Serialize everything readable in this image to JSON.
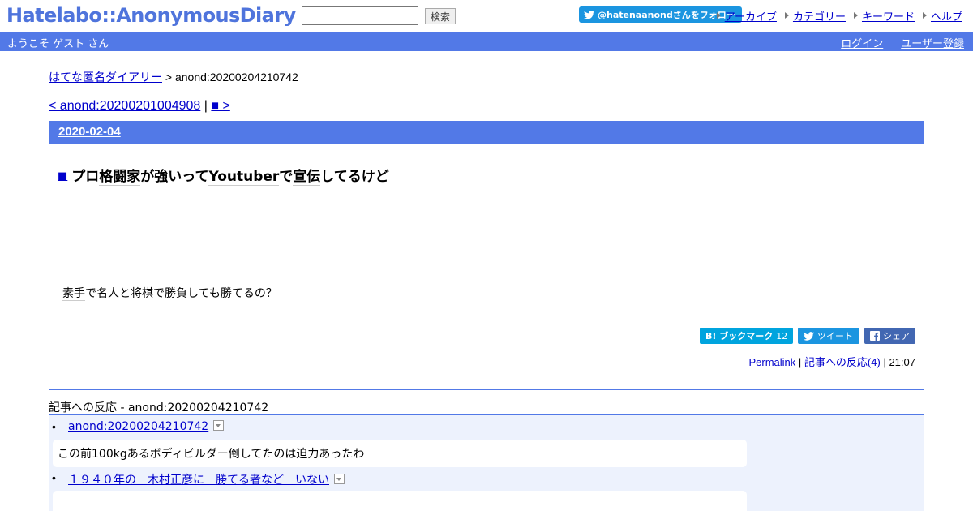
{
  "header": {
    "logo": "Hatelabo::AnonymousDiary",
    "search_placeholder": "",
    "search_button": "検索",
    "twitter_follow": "@hatenaanondさんをフォロー",
    "links": [
      "アーカイブ",
      "カテゴリー",
      "キーワード",
      "ヘルプ"
    ]
  },
  "bar": {
    "welcome": "ようこそ ゲスト さん",
    "login": "ログイン",
    "register": "ユーザー登録"
  },
  "breadcrumb": {
    "home": "はてな匿名ダイアリー",
    "separator": ">",
    "current": "anond:20200204210742"
  },
  "pager": {
    "prev": "< anond:20200201004908",
    "separator": "|",
    "next": "■ >"
  },
  "entry": {
    "date": "2020-02-04",
    "square": "■",
    "title_parts": [
      "プロ",
      "格闘家",
      "が強いって",
      "Youtuber",
      "で",
      "宣伝",
      "してるけど"
    ],
    "body_parts": [
      "素手",
      "で名人と将棋で勝負しても勝てるの？"
    ],
    "share": {
      "hatena_label": "B! ブックマーク",
      "hatena_count": "12",
      "tweet_label": "ツイート",
      "fb_label": "シェア"
    },
    "permalink": "Permalink",
    "sep": "|",
    "reactions_link": "記事への反応(4)",
    "time": "21:07"
  },
  "reactions": {
    "title_parts": [
      "記事への反応",
      " - anond:20200204210742"
    ],
    "items": [
      {
        "bullet": "•",
        "link": "anond:20200204210742",
        "body": "この前100kgあるボディビルダー倒してたのは迫力あったわ"
      },
      {
        "bullet": "•",
        "link": "１９４０年の　木村正彦に　勝てる者など　いない",
        "body": ""
      }
    ]
  },
  "colors": {
    "accent": "#5279e7",
    "link": "#0000cc",
    "reaction_bg": "#edf2fd",
    "hatena": "#00a4de",
    "twitter": "#1b95e0",
    "facebook": "#4267b2"
  }
}
